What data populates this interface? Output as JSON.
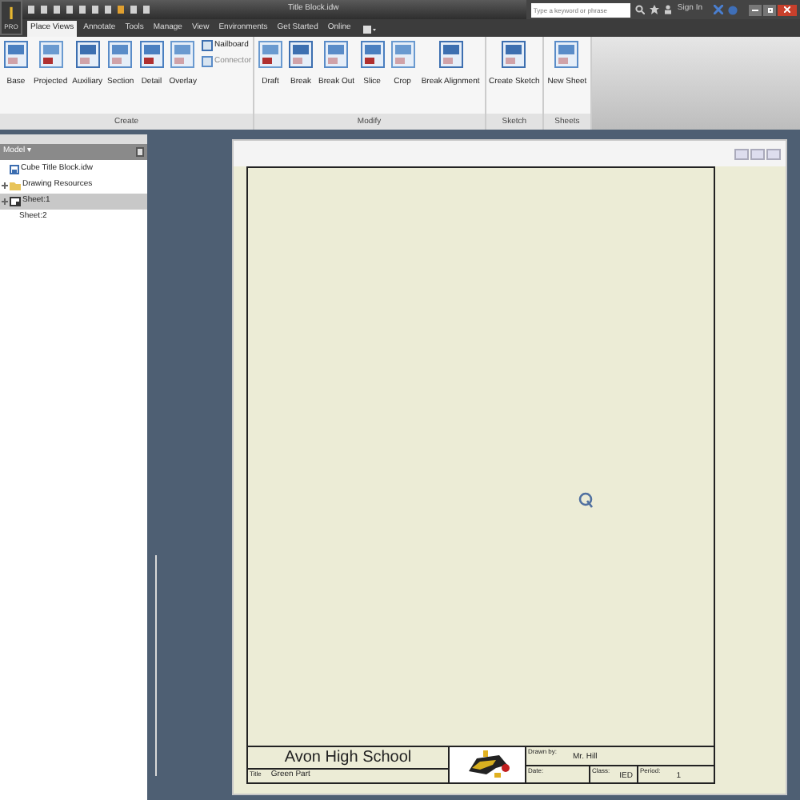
{
  "title_bar": {
    "app_letter": "I",
    "app_menu": "PRO",
    "document_title": "Title Block.idw",
    "search": {
      "placeholder": "Type a keyword or phrase"
    },
    "sign_in": "Sign In"
  },
  "tabs": [
    {
      "label": "Place Views",
      "selected": true
    },
    {
      "label": "Annotate",
      "selected": false
    },
    {
      "label": "Tools",
      "selected": false
    },
    {
      "label": "Manage",
      "selected": false
    },
    {
      "label": "View",
      "selected": false
    },
    {
      "label": "Environments",
      "selected": false
    },
    {
      "label": "Get Started",
      "selected": false
    },
    {
      "label": "Online",
      "selected": false
    }
  ],
  "ribbon": [
    {
      "label": "Create",
      "tools": [
        {
          "label": "Base",
          "kind": "large",
          "disabled": false
        },
        {
          "label": "Projected",
          "kind": "large",
          "disabled": false
        },
        {
          "label": "Auxiliary",
          "kind": "large",
          "disabled": false
        },
        {
          "label": "Section",
          "kind": "large",
          "disabled": false
        },
        {
          "label": "Detail",
          "kind": "large",
          "disabled": false
        },
        {
          "label": "Overlay",
          "kind": "large",
          "disabled": false
        },
        {
          "label": "Nailboard",
          "kind": "small",
          "disabled": false
        },
        {
          "label": "Connector",
          "kind": "small",
          "disabled": true
        }
      ]
    },
    {
      "label": "Modify",
      "tools": [
        {
          "label": "Draft",
          "kind": "large",
          "disabled": false
        },
        {
          "label": "Break",
          "kind": "large",
          "disabled": false
        },
        {
          "label": "Break Out",
          "kind": "large",
          "disabled": false
        },
        {
          "label": "Slice",
          "kind": "large",
          "disabled": false
        },
        {
          "label": "Crop",
          "kind": "large",
          "disabled": false
        },
        {
          "label": "Break Alignment",
          "kind": "wide",
          "disabled": false
        }
      ]
    },
    {
      "label": "Sketch",
      "tools": [
        {
          "label": "Create Sketch",
          "kind": "large",
          "disabled": false
        }
      ]
    },
    {
      "label": "Sheets",
      "tools": [
        {
          "label": "New Sheet",
          "kind": "large",
          "disabled": false
        }
      ]
    }
  ],
  "browser": {
    "title": "Model",
    "menu_caret": "▾",
    "items": [
      {
        "label": "Cube Title Block.idw",
        "kind": "document",
        "expandable": false,
        "selected": false
      },
      {
        "label": "Drawing Resources",
        "kind": "folder",
        "expandable": true,
        "selected": false
      },
      {
        "label": "Sheet:1",
        "kind": "sheet",
        "expandable": true,
        "selected": true
      },
      {
        "label": "Sheet:2",
        "kind": "none",
        "expandable": false,
        "selected": false
      }
    ]
  },
  "title_block": {
    "school": "Avon High School",
    "drawn_by_label": "Drawn by:",
    "drawn_by": "Mr. Hill",
    "title_label": "Title",
    "title": "Green Part",
    "date_label": "Date:",
    "class_label": "Class:",
    "class": "IED",
    "period_label": "Period:",
    "period": "1"
  }
}
